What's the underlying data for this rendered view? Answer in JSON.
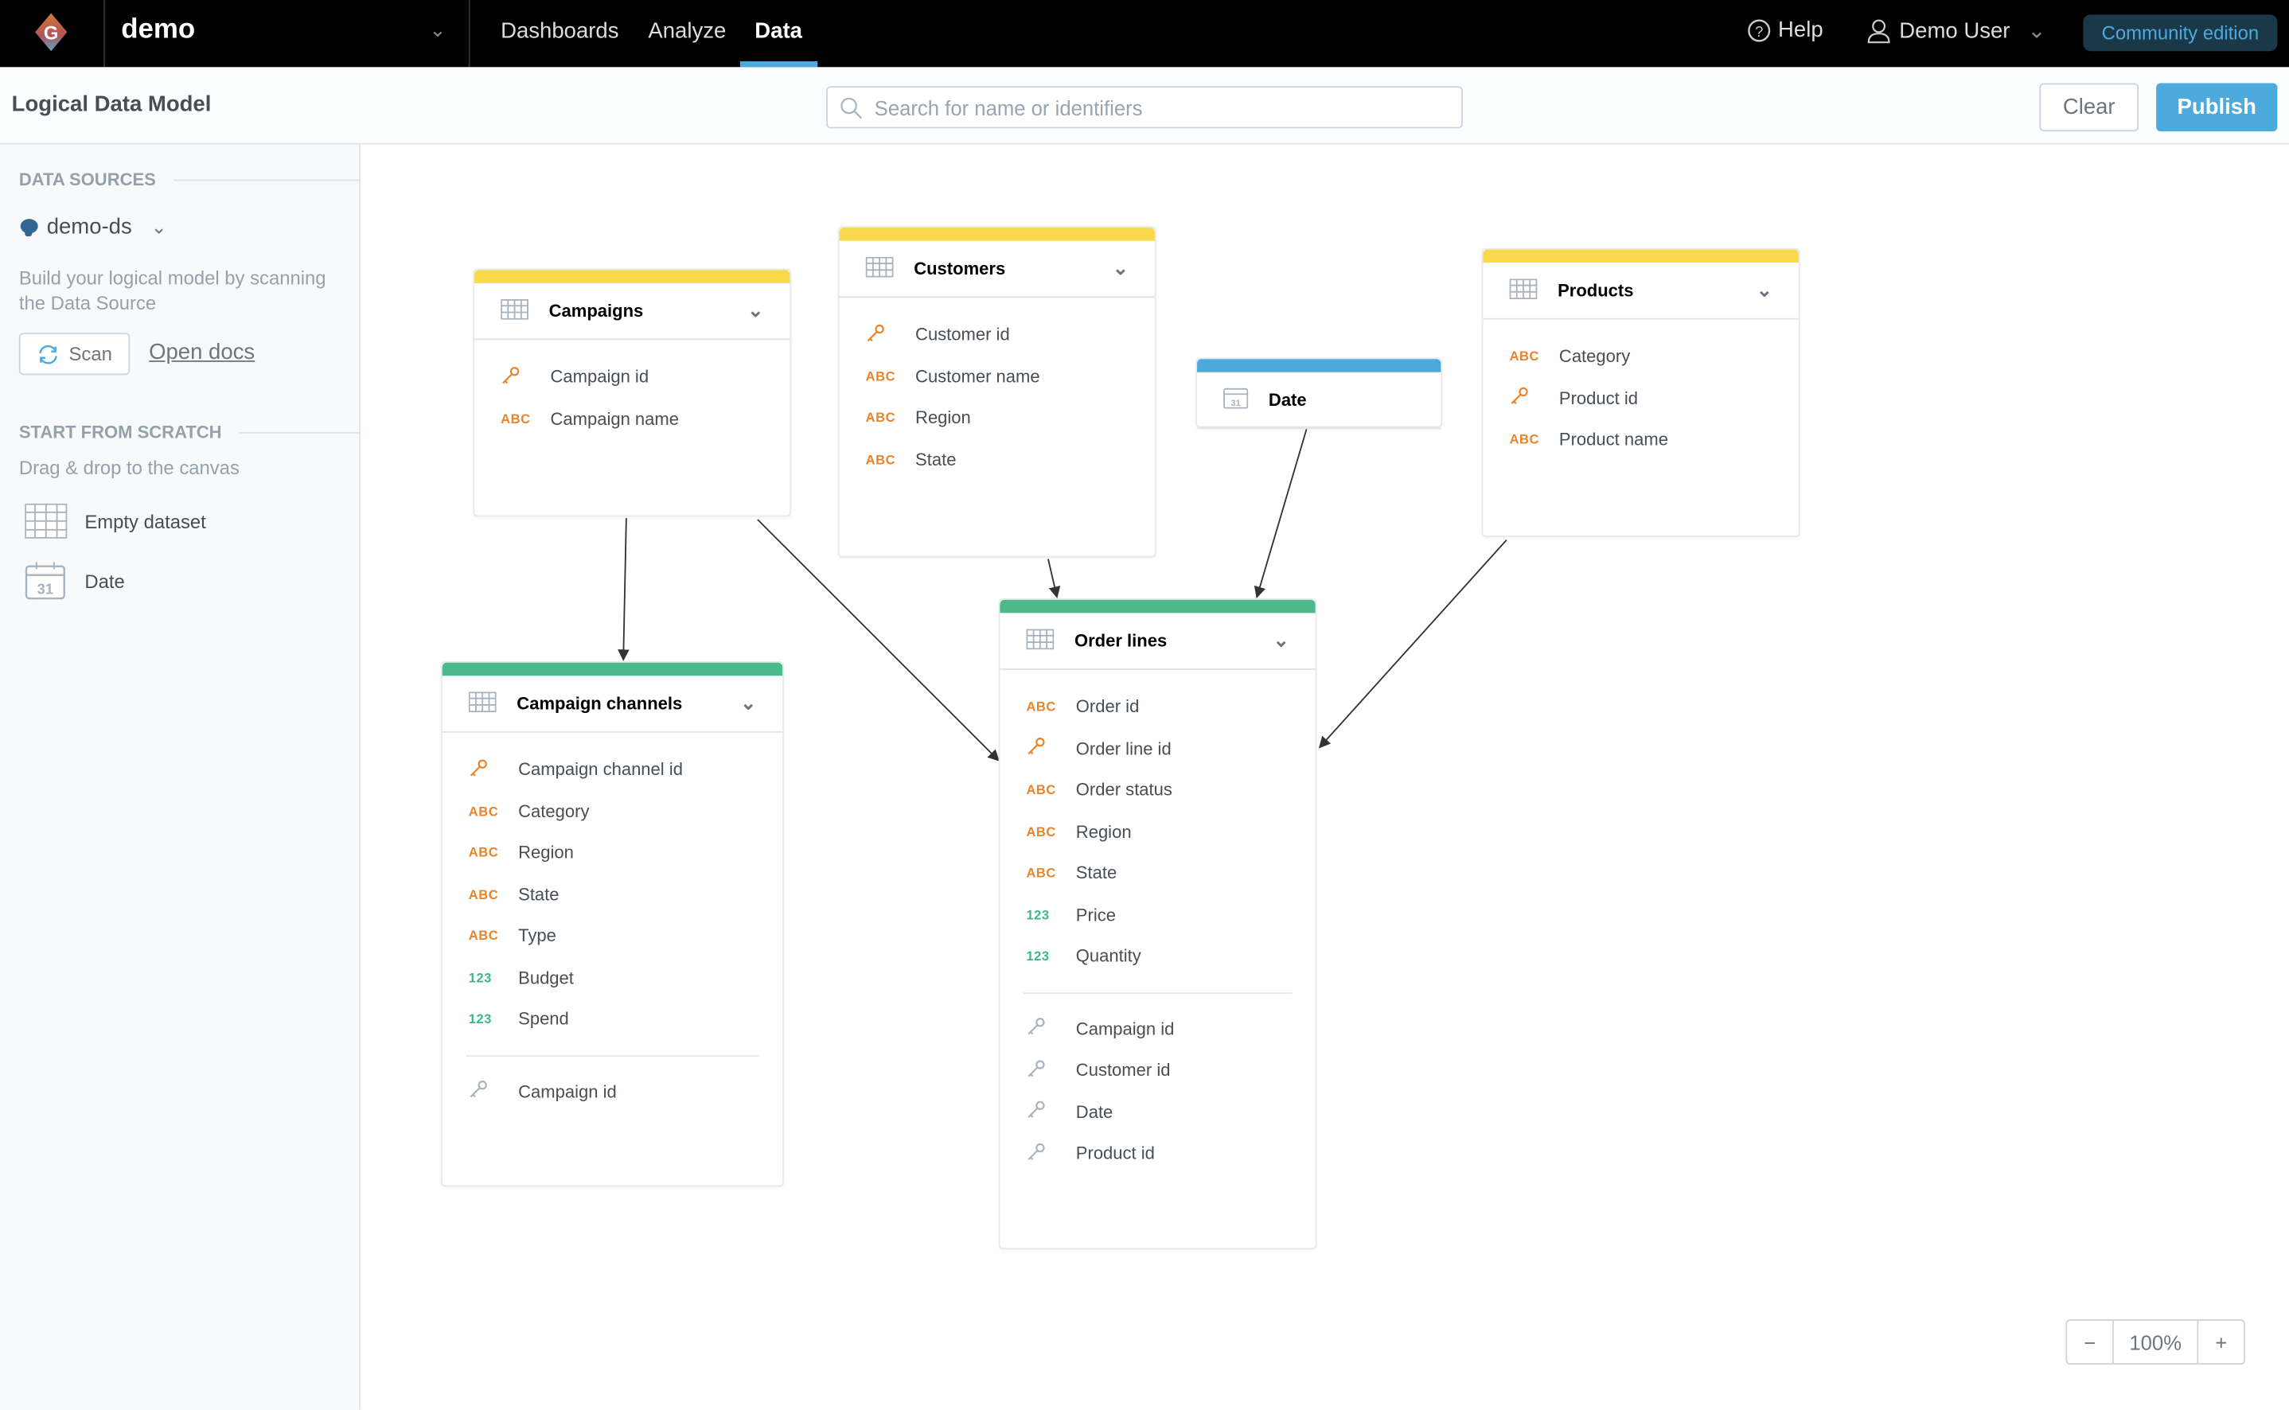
{
  "topbar": {
    "workspace": "demo",
    "nav": [
      {
        "label": "Dashboards"
      },
      {
        "label": "Analyze"
      },
      {
        "label": "Data",
        "active": true
      }
    ],
    "help": "Help",
    "user": "Demo User",
    "edition": "Community edition"
  },
  "header": {
    "title": "Logical Data Model",
    "search_placeholder": "Search for name or identifiers",
    "search_value": "",
    "clear": "Clear",
    "publish": "Publish"
  },
  "sidebar": {
    "data_sources_heading": "DATA SOURCES",
    "data_source": "demo-ds",
    "description": "Build your logical model by scanning the Data Source",
    "scan": "Scan",
    "open_docs": "Open docs",
    "scratch_heading": "START FROM SCRATCH",
    "scratch_description": "Drag & drop to the canvas",
    "scratch_items": [
      {
        "label": "Empty dataset",
        "icon": "table-icon"
      },
      {
        "label": "Date",
        "icon": "calendar-icon"
      }
    ]
  },
  "colors": {
    "yellow": "#f8d94a",
    "green": "#4cba8a",
    "blue": "#4daadd",
    "abc": "#e8842b",
    "num": "#3fb58f",
    "fk": "#a9b3bd"
  },
  "type_labels": {
    "attr": "ABC",
    "fact": "123"
  },
  "tables": [
    {
      "name": "Campaigns",
      "kind": "dataset",
      "color": "yellow",
      "fields": [
        {
          "t": "pk",
          "n": "Campaign id"
        },
        {
          "t": "attr",
          "n": "Campaign name"
        }
      ],
      "refs": []
    },
    {
      "name": "Customers",
      "kind": "dataset",
      "color": "yellow",
      "fields": [
        {
          "t": "pk",
          "n": "Customer id"
        },
        {
          "t": "attr",
          "n": "Customer name"
        },
        {
          "t": "attr",
          "n": "Region"
        },
        {
          "t": "attr",
          "n": "State"
        }
      ],
      "refs": []
    },
    {
      "name": "Date",
      "kind": "date",
      "color": "blue",
      "fields": [],
      "refs": []
    },
    {
      "name": "Products",
      "kind": "dataset",
      "color": "yellow",
      "fields": [
        {
          "t": "attr",
          "n": "Category"
        },
        {
          "t": "pk",
          "n": "Product id"
        },
        {
          "t": "attr",
          "n": "Product name"
        }
      ],
      "refs": []
    },
    {
      "name": "Campaign channels",
      "kind": "dataset",
      "color": "green",
      "fields": [
        {
          "t": "pk",
          "n": "Campaign channel id"
        },
        {
          "t": "attr",
          "n": "Category"
        },
        {
          "t": "attr",
          "n": "Region"
        },
        {
          "t": "attr",
          "n": "State"
        },
        {
          "t": "attr",
          "n": "Type"
        },
        {
          "t": "fact",
          "n": "Budget"
        },
        {
          "t": "fact",
          "n": "Spend"
        }
      ],
      "refs": [
        "Campaign id"
      ]
    },
    {
      "name": "Order lines",
      "kind": "dataset",
      "color": "green",
      "fields": [
        {
          "t": "attr",
          "n": "Order id"
        },
        {
          "t": "pk",
          "n": "Order line id"
        },
        {
          "t": "attr",
          "n": "Order status"
        },
        {
          "t": "attr",
          "n": "Region"
        },
        {
          "t": "attr",
          "n": "State"
        },
        {
          "t": "fact",
          "n": "Price"
        },
        {
          "t": "fact",
          "n": "Quantity"
        }
      ],
      "refs": [
        "Campaign id",
        "Customer id",
        "Date",
        "Product id"
      ]
    }
  ],
  "relationships": [
    {
      "from": "Campaigns",
      "to": "Campaign channels"
    },
    {
      "from": "Campaigns",
      "to": "Order lines"
    },
    {
      "from": "Customers",
      "to": "Order lines"
    },
    {
      "from": "Date",
      "to": "Order lines"
    },
    {
      "from": "Products",
      "to": "Order lines"
    }
  ],
  "zoom": {
    "minus": "−",
    "value": "100%",
    "plus": "+"
  }
}
